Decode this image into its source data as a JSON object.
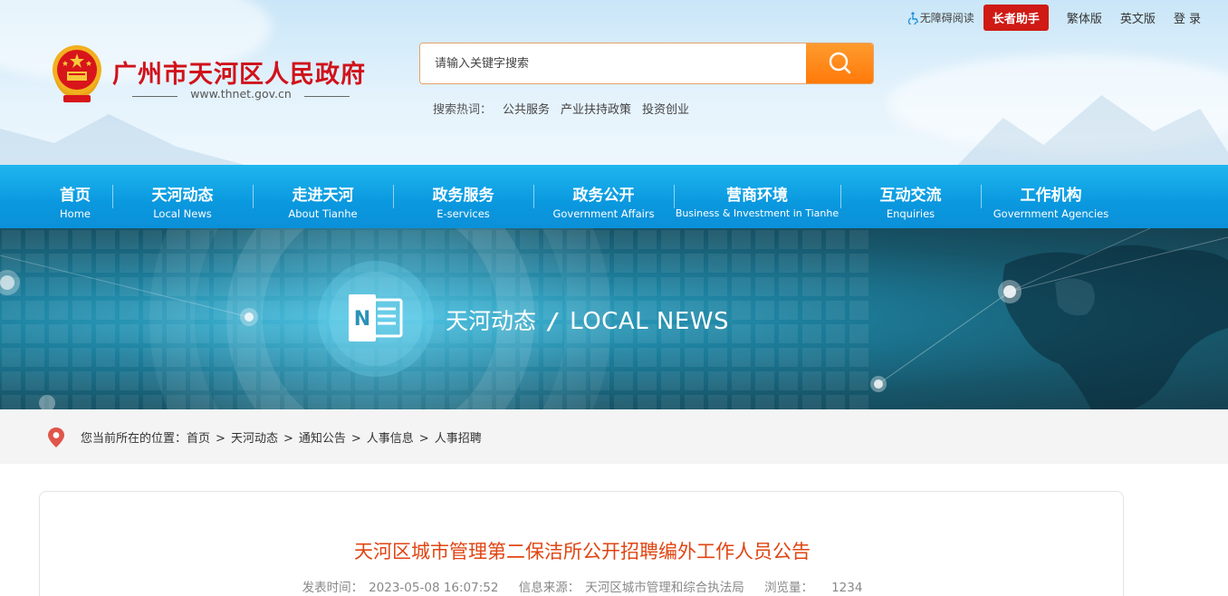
{
  "header": {
    "site_title": "广州市天河区人民政府",
    "site_url": "www.thnet.gov.cn",
    "search": {
      "placeholder": "请输入关键字搜索"
    },
    "hotwords_label": "搜索热词：",
    "hotwords": [
      "公共服务",
      "产业扶持政策",
      "投资创业"
    ],
    "toplinks": {
      "accessibility": "无障碍阅读",
      "elder_mode": "长者助手",
      "traditional": "繁体版",
      "english": "英文版",
      "login": "登 录"
    }
  },
  "nav": [
    {
      "cn": "首页",
      "en": "Home"
    },
    {
      "cn": "天河动态",
      "en": "Local News"
    },
    {
      "cn": "走进天河",
      "en": "About Tianhe"
    },
    {
      "cn": "政务服务",
      "en": "E-services"
    },
    {
      "cn": "政务公开",
      "en": "Government Affairs"
    },
    {
      "cn": "营商环境",
      "en": "Business & Investment in Tianhe"
    },
    {
      "cn": "互动交流",
      "en": "Enquiries"
    },
    {
      "cn": "工作机构",
      "en": "Government Agencies"
    }
  ],
  "banner": {
    "cn": "天河动态",
    "en": "LOCAL NEWS",
    "icon_letter": "N"
  },
  "breadcrumb": {
    "label": "您当前所在的位置：",
    "items": [
      "首页",
      "天河动态",
      "通知公告",
      "人事信息",
      "人事招聘"
    ]
  },
  "article": {
    "title": "天河区城市管理第二保洁所公开招聘编外工作人员公告",
    "publish_label": "发表时间：",
    "publish_time": "2023-05-08 16:07:52",
    "source_label": "信息来源：",
    "source": "天河区城市管理和综合执法局",
    "views_label": "浏览量：",
    "views": "1234"
  },
  "colors": {
    "brand_red": "#d0121b",
    "nav_blue": "#0b98df",
    "search_orange": "#ff8a1c",
    "title_orange": "#e04512"
  }
}
